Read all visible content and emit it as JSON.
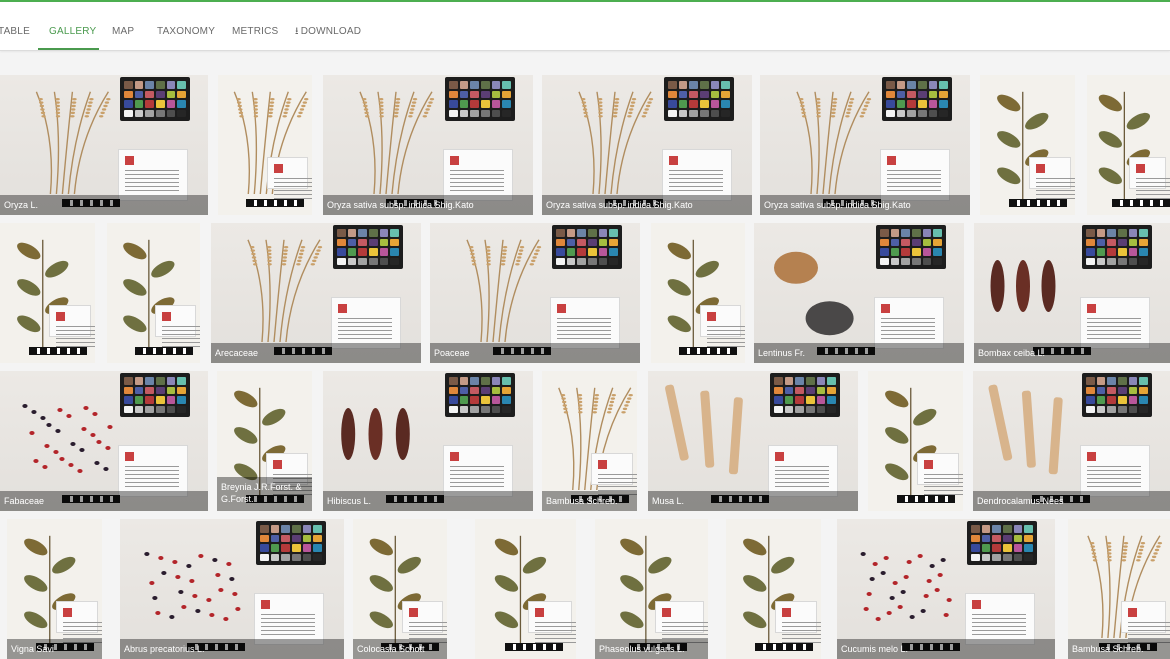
{
  "tabs": [
    {
      "label": "TABLE"
    },
    {
      "label": "GALLERY"
    },
    {
      "label": "MAP"
    },
    {
      "label": "TAXONOMY"
    },
    {
      "label": "METRICS"
    },
    {
      "label": "DOWNLOAD"
    }
  ],
  "active_tab": "GALLERY",
  "accent_color": "#4a9a4e",
  "gallery": {
    "rows": [
      [
        {
          "caption": "Oryza L.",
          "kind": "photo",
          "subject": "grass"
        },
        {
          "caption": "",
          "kind": "sheet",
          "subject": "grass"
        },
        {
          "caption": "Oryza sativa subsp. indica Shig.Kato",
          "kind": "photo",
          "subject": "grass"
        },
        {
          "caption": "Oryza sativa subsp. indica Shig.Kato",
          "kind": "photo",
          "subject": "grass"
        },
        {
          "caption": "Oryza sativa subsp. indica Shig.Kato",
          "kind": "photo",
          "subject": "grass"
        },
        {
          "caption": "",
          "kind": "sheet",
          "subject": "leaves"
        },
        {
          "caption": "",
          "kind": "sheet",
          "subject": "leaves"
        }
      ],
      [
        {
          "caption": "",
          "kind": "sheet",
          "subject": "leaves"
        },
        {
          "caption": "",
          "kind": "sheet",
          "subject": "leaves"
        },
        {
          "caption": "Arecaceae",
          "kind": "photo",
          "subject": "grass"
        },
        {
          "caption": "Poaceae",
          "kind": "photo",
          "subject": "grass"
        },
        {
          "caption": "",
          "kind": "sheet",
          "subject": "leaves"
        },
        {
          "caption": "Lentinus Fr.",
          "kind": "photo",
          "subject": "fungus"
        },
        {
          "caption": "Bombax ceiba L.",
          "kind": "photo",
          "subject": "pods"
        }
      ],
      [
        {
          "caption": "Fabaceae",
          "kind": "photo",
          "subject": "seeds"
        },
        {
          "caption": "Breynia J.R.Forst. & G.Forst.",
          "kind": "sheet",
          "subject": "leaves"
        },
        {
          "caption": "Hibiscus L.",
          "kind": "photo",
          "subject": "pods"
        },
        {
          "caption": "Bambusa Schreb.",
          "kind": "sheet",
          "subject": "grass"
        },
        {
          "caption": "Musa L.",
          "kind": "photo",
          "subject": "sticks"
        },
        {
          "caption": "",
          "kind": "sheet",
          "subject": "leaves"
        },
        {
          "caption": "Dendrocalamus Nees",
          "kind": "photo",
          "subject": "sticks"
        }
      ],
      [
        {
          "caption": "Vigna Savi",
          "kind": "sheet",
          "subject": "leaves"
        },
        {
          "caption": "Abrus precatorius L.",
          "kind": "photo",
          "subject": "seeds"
        },
        {
          "caption": "Colocasia Schott",
          "kind": "sheet",
          "subject": "leaves"
        },
        {
          "caption": "",
          "kind": "sheet",
          "subject": "leaves"
        },
        {
          "caption": "Phaseolus vulgaris L.",
          "kind": "sheet",
          "subject": "leaves"
        },
        {
          "caption": "",
          "kind": "sheet",
          "subject": "leaves"
        },
        {
          "caption": "Cucumis melo L.",
          "kind": "photo",
          "subject": "seeds"
        },
        {
          "caption": "Bambusa Schreb.",
          "kind": "sheet",
          "subject": "grass"
        }
      ]
    ]
  }
}
